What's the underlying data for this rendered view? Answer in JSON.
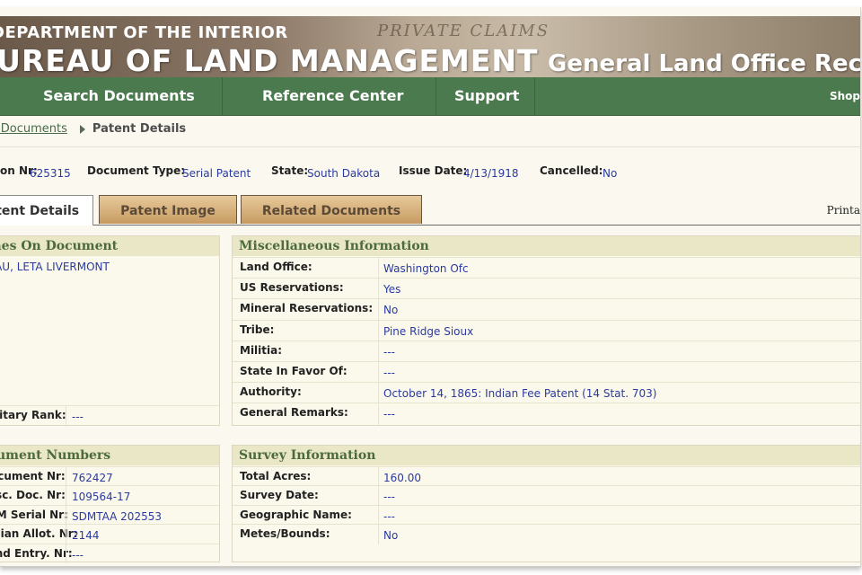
{
  "banner": {
    "dept": "DEPARTMENT OF THE INTERIOR",
    "agency": "BUREAU OF LAND MANAGEMENT",
    "site": "General Land Office Rec",
    "script_text": "PRIVATE CLAIMS"
  },
  "nav": {
    "items": [
      "Search Documents",
      "Reference Center",
      "Support"
    ],
    "shop": "Shop"
  },
  "breadcrumb": {
    "link": "Search Documents",
    "current": "Patent Details"
  },
  "summary": {
    "accession_label": "Accession Nr:",
    "accession": "625315",
    "doctype_label": "Document Type:",
    "doctype": "Serial Patent",
    "state_label": "State:",
    "state": "South Dakota",
    "issue_label": "Issue Date:",
    "issue": "4/13/1918",
    "cancelled_label": "Cancelled:",
    "cancelled": "No"
  },
  "tabs": {
    "items": [
      "Patent Details",
      "Patent Image",
      "Related Documents"
    ],
    "printable": "Printa"
  },
  "names": {
    "title": "Names On Document",
    "name": "LAREAU, LETA LIVERMONT",
    "military_label": "Military Rank:",
    "military": "---"
  },
  "misc": {
    "title": "Miscellaneous Information",
    "rows": [
      {
        "k": "Land Office:",
        "v": "Washington Ofc"
      },
      {
        "k": "US Reservations:",
        "v": "Yes"
      },
      {
        "k": "Mineral Reservations:",
        "v": "No"
      },
      {
        "k": "Tribe:",
        "v": "Pine Ridge Sioux"
      },
      {
        "k": "Militia:",
        "v": "---"
      },
      {
        "k": "State In Favor Of:",
        "v": "---"
      },
      {
        "k": "Authority:",
        "v": "October 14, 1865: Indian Fee Patent (14 Stat. 703)"
      },
      {
        "k": "General Remarks:",
        "v": "---"
      }
    ]
  },
  "docnums": {
    "title": "Document Numbers",
    "rows": [
      {
        "k": "Document Nr:",
        "v": "762427"
      },
      {
        "k": "Misc. Doc. Nr:",
        "v": "109564-17"
      },
      {
        "k": "BLM Serial Nr:",
        "v": "SDMTAA 202553"
      },
      {
        "k": "Indian Allot. Nr:",
        "v": "2144"
      },
      {
        "k": "Land Entry. Nr:",
        "v": "---"
      }
    ]
  },
  "survey": {
    "title": "Survey Information",
    "rows": [
      {
        "k": "Total Acres:",
        "v": "160.00"
      },
      {
        "k": "Survey Date:",
        "v": "---"
      },
      {
        "k": "Geographic Name:",
        "v": "---"
      },
      {
        "k": "Metes/Bounds:",
        "v": "No"
      }
    ]
  }
}
